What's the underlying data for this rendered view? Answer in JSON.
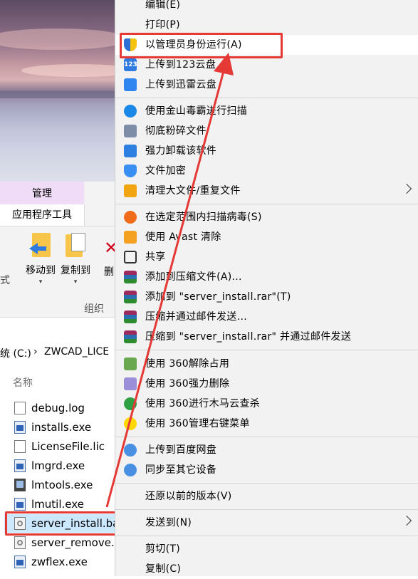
{
  "explorer": {
    "ribbon": {
      "context_tab_top": "管理",
      "context_tab_bottom": "应用程序工具",
      "left_cut_text": "式",
      "move_to": "移动到",
      "copy_to": "复制到",
      "delete_cut": "删",
      "group_label": "组织"
    },
    "address": {
      "drive": "统 (C:)",
      "separator": "›",
      "folder": "ZWCAD_LICE"
    },
    "column_header": "名称",
    "files": [
      {
        "name": "debug.log",
        "icon": "document-icon"
      },
      {
        "name": "installs.exe",
        "icon": "exe-icon"
      },
      {
        "name": "LicenseFile.lic",
        "icon": "document-icon"
      },
      {
        "name": "lmgrd.exe",
        "icon": "exe-icon"
      },
      {
        "name": "lmtools.exe",
        "icon": "tool-icon"
      },
      {
        "name": "lmutil.exe",
        "icon": "exe-icon"
      },
      {
        "name": "server_install.ba",
        "icon": "batch-file-icon"
      },
      {
        "name": "server_remove.b",
        "icon": "batch-file-icon"
      },
      {
        "name": "zwflex.exe",
        "icon": "exe-icon"
      }
    ]
  },
  "menu": {
    "items": [
      {
        "label": "编辑(E)",
        "icon": "none"
      },
      {
        "label": "打印(P)",
        "icon": "none"
      },
      {
        "label": "以管理员身份运行(A)",
        "icon": "uac-shield-icon"
      },
      {
        "label": "上传到123云盘",
        "icon": "123pan-icon"
      },
      {
        "label": "上传到迅雷云盘",
        "icon": "xunlei-icon"
      },
      {
        "label": "使用金山毒霸进行扫描",
        "icon": "jinshan-icon"
      },
      {
        "label": "彻底粉碎文件",
        "icon": "shredder-icon"
      },
      {
        "label": "强力卸载该软件",
        "icon": "uninstall-icon"
      },
      {
        "label": "文件加密",
        "icon": "encrypt-shield-icon"
      },
      {
        "label": "清理大文件/重复文件",
        "icon": "clean-folder-icon"
      },
      {
        "label": "在选定范围内扫描病毒(S)",
        "icon": "virus-scan-icon"
      },
      {
        "label": "使用 Avast 清除",
        "icon": "avast-icon"
      },
      {
        "label": "共享",
        "icon": "share-icon"
      },
      {
        "label": "添加到压缩文件(A)...",
        "icon": "winrar-icon"
      },
      {
        "label": "添加到 \"server_install.rar\"(T)",
        "icon": "winrar-icon"
      },
      {
        "label": "压缩并通过邮件发送...",
        "icon": "winrar-icon"
      },
      {
        "label": "压缩到 \"server_install.rar\" 并通过邮件发送",
        "icon": "winrar-icon"
      },
      {
        "label": "使用 360解除占用",
        "icon": "360-unlock-icon"
      },
      {
        "label": "使用 360强力删除",
        "icon": "360-delete-icon"
      },
      {
        "label": "使用 360进行木马云查杀",
        "icon": "360-trojan-icon"
      },
      {
        "label": "使用 360管理右键菜单",
        "icon": "360-menu-icon"
      },
      {
        "label": "上传到百度网盘",
        "icon": "baidu-netdisk-icon"
      },
      {
        "label": "同步至其它设备",
        "icon": "baidu-sync-icon"
      },
      {
        "label": "还原以前的版本(V)",
        "icon": "none"
      },
      {
        "label": "发送到(N)",
        "icon": "none"
      },
      {
        "label": "剪切(T)",
        "icon": "none"
      },
      {
        "label": "复制(C)",
        "icon": "none"
      }
    ]
  },
  "annotation": {
    "highlight_color": "#e53935"
  }
}
